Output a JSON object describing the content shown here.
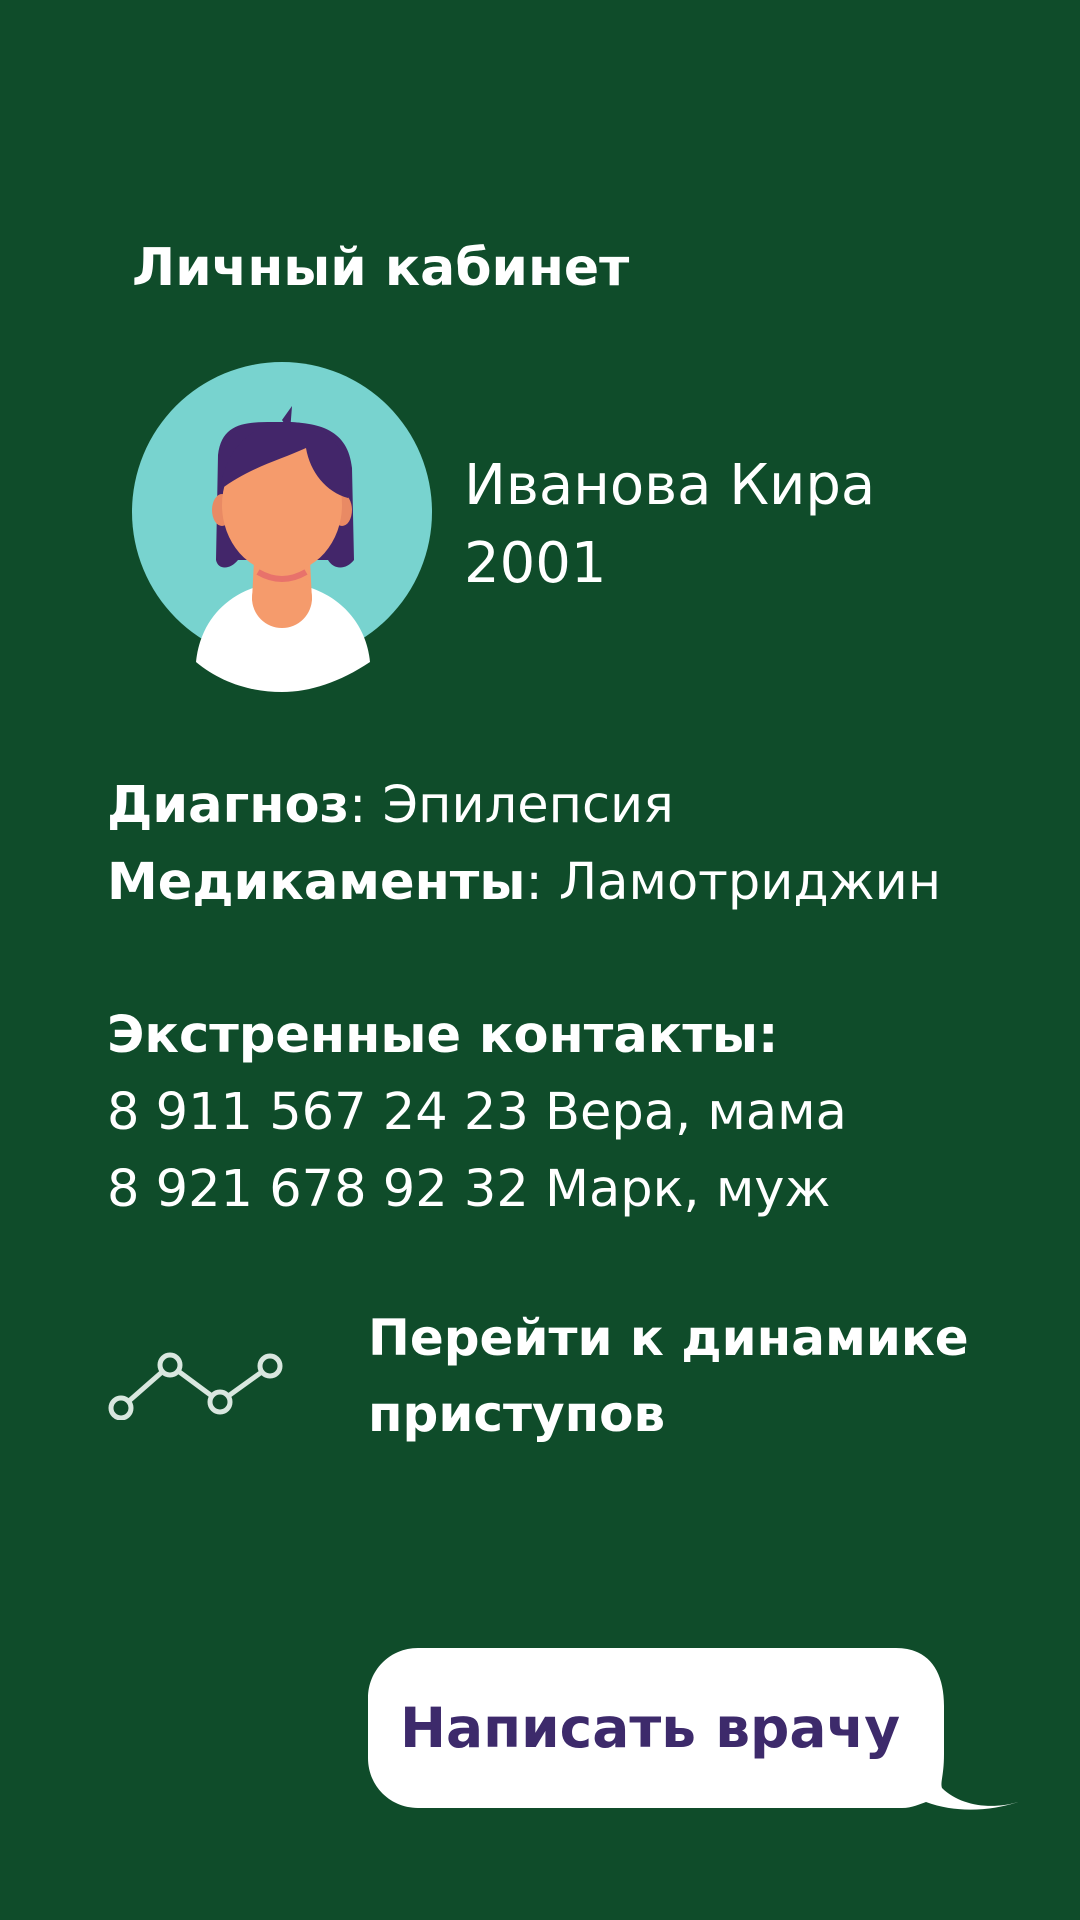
{
  "header": {
    "title": "Личный кабинет"
  },
  "profile": {
    "name": "Иванова Кира",
    "year": "2001",
    "avatar_icon": "female-user-avatar-icon"
  },
  "medical": {
    "diagnosis_label": "Диагноз",
    "diagnosis_value": ": Эпилепсия",
    "medication_label": "Медикаменты",
    "medication_value": ": Ламотриджин"
  },
  "contacts": {
    "title": "Экстренные контакты:",
    "items": [
      "8 911 567 24 23 Вера, мама",
      "8 921 678 92 32 Марк, муж"
    ]
  },
  "dynamics_link": {
    "label": "Перейти к динамике приступов",
    "icon": "line-chart-icon"
  },
  "chat": {
    "button_label": "Написать врачу",
    "icon": "speech-bubble"
  },
  "colors": {
    "background": "#0f4c2a",
    "text": "#ffffff",
    "avatar_circle": "#78d3cf",
    "hair": "#43266a",
    "skin": "#f59b6c",
    "button_text": "#3d2a6b"
  }
}
